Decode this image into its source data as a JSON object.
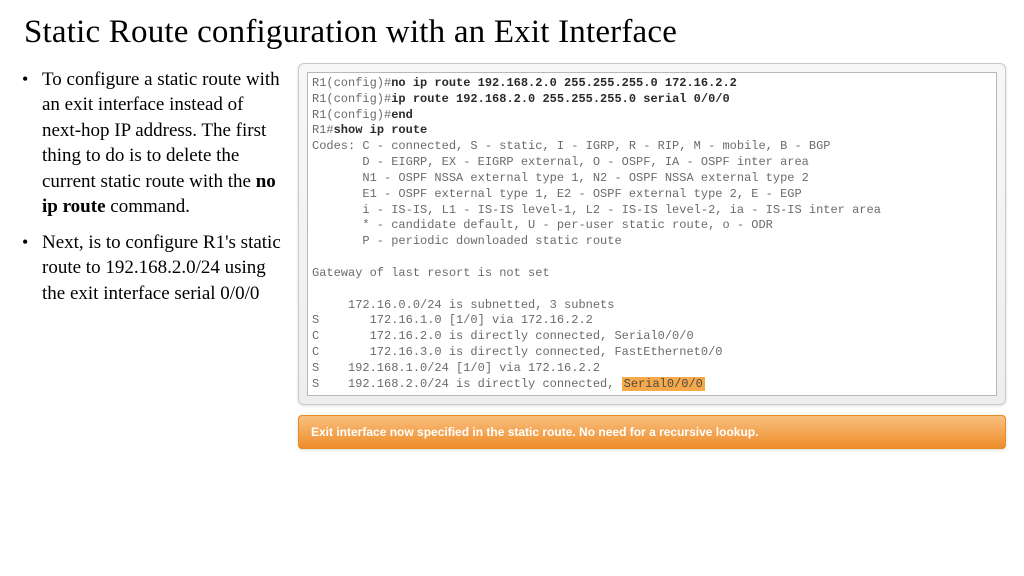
{
  "title": "Static Route configuration with an Exit Interface",
  "bullets": [
    {
      "pre": "To configure a static route with an exit interface instead of next-hop IP address. The first thing to do is to delete the current static route with the ",
      "bold": "no ip route",
      "post": " command."
    },
    {
      "pre": "Next, is to configure R1's static route to 192.168.2.0/24 using the exit interface serial 0/0/0",
      "bold": "",
      "post": ""
    }
  ],
  "terminal": {
    "lines": [
      {
        "prompt": "R1(config)#",
        "cmd": "no ip route 192.168.2.0 255.255.255.0 172.16.2.2"
      },
      {
        "prompt": "R1(config)#",
        "cmd": "ip route 192.168.2.0 255.255.255.0 serial 0/0/0"
      },
      {
        "prompt": "R1(config)#",
        "cmd": "end"
      },
      {
        "prompt": "R1#",
        "cmd": "show ip route"
      }
    ],
    "codes": [
      "Codes: C - connected, S - static, I - IGRP, R - RIP, M - mobile, B - BGP",
      "       D - EIGRP, EX - EIGRP external, O - OSPF, IA - OSPF inter area",
      "       N1 - OSPF NSSA external type 1, N2 - OSPF NSSA external type 2",
      "       E1 - OSPF external type 1, E2 - OSPF external type 2, E - EGP",
      "       i - IS-IS, L1 - IS-IS level-1, L2 - IS-IS level-2, ia - IS-IS inter area",
      "       * - candidate default, U - per-user static route, o - ODR",
      "       P - periodic downloaded static route"
    ],
    "gateway": "Gateway of last resort is not set",
    "routes": [
      "     172.16.0.0/24 is subnetted, 3 subnets",
      "S       172.16.1.0 [1/0] via 172.16.2.2",
      "C       172.16.2.0 is directly connected, Serial0/0/0",
      "C       172.16.3.0 is directly connected, FastEthernet0/0",
      "S    192.168.1.0/24 [1/0] via 172.16.2.2"
    ],
    "last_route_pre": "S    192.168.2.0/24 is directly connected, ",
    "highlight": "Serial0/0/0"
  },
  "note": "Exit interface now specified in the static route. No need for a recursive lookup."
}
